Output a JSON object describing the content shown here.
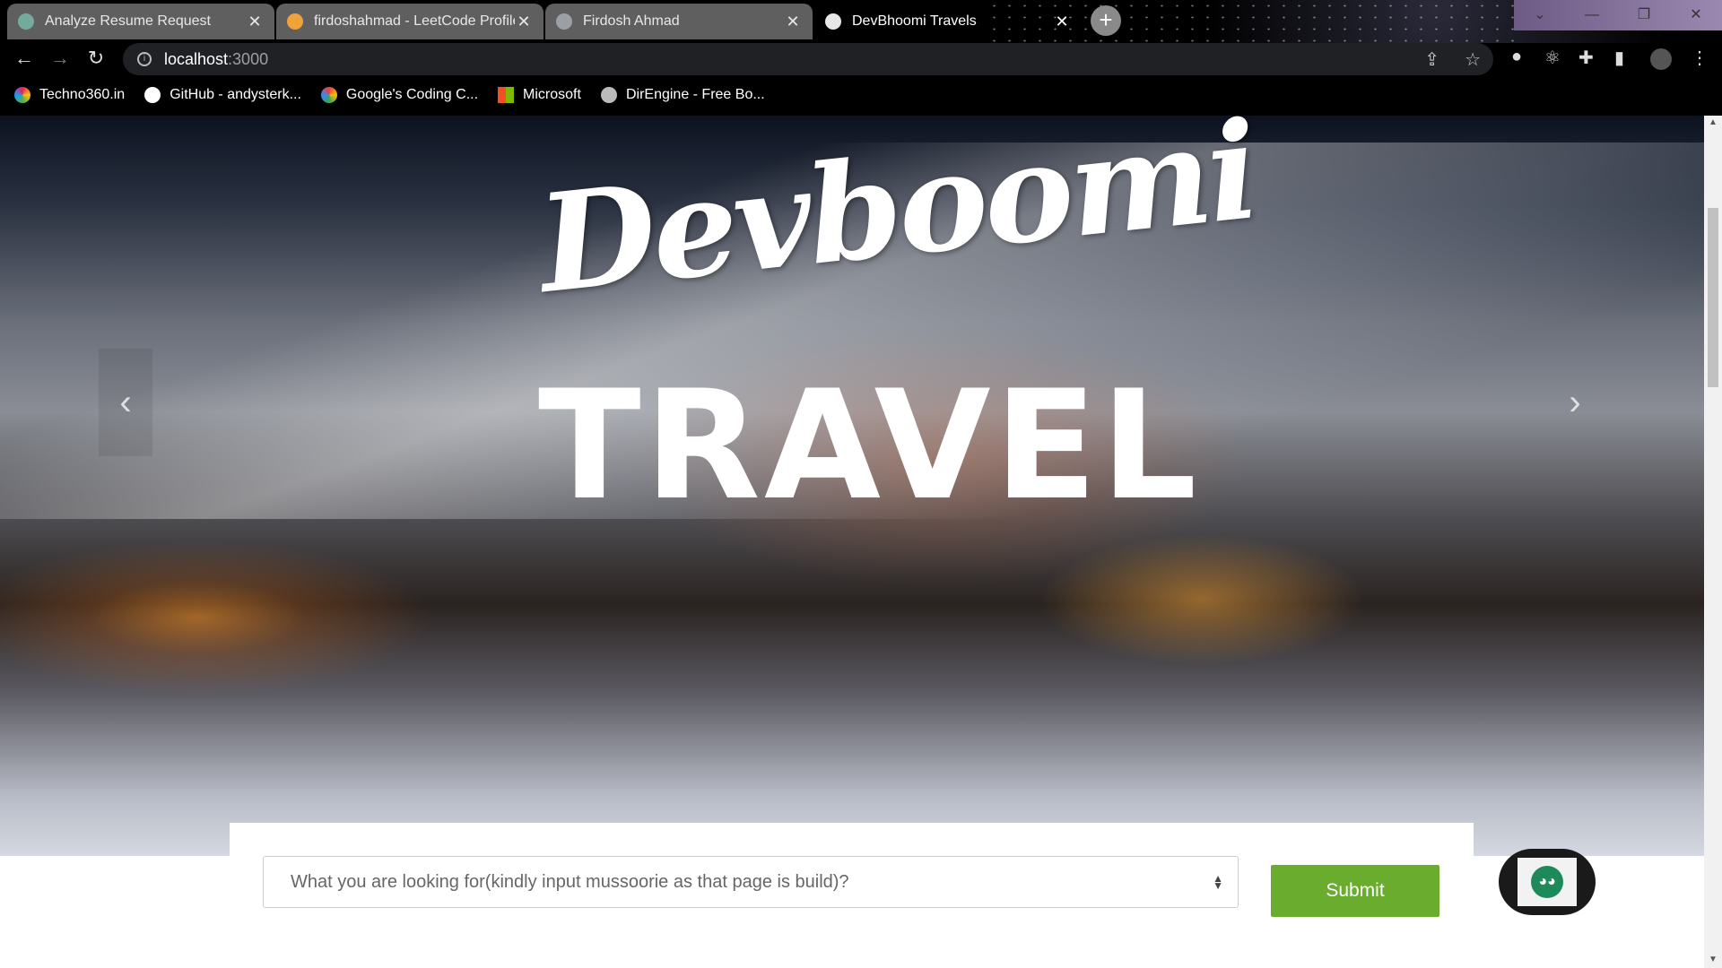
{
  "browser": {
    "tabs": [
      {
        "title": "Analyze Resume Request",
        "favicon_color": "#74aa9c"
      },
      {
        "title": "firdoshahmad - LeetCode Profile",
        "favicon_color": "#f0a33a"
      },
      {
        "title": "Firdosh Ahmad",
        "favicon_color": "#9aa0a6"
      },
      {
        "title": "DevBhoomi Travels",
        "favicon_color": "#e8e8e8"
      }
    ],
    "new_tab": "+",
    "address": {
      "host": "localhost",
      "port": ":3000"
    },
    "bookmarks": [
      {
        "label": "Techno360.in",
        "color": "#e91e63"
      },
      {
        "label": "GitHub - andysterk...",
        "color": "#ffffff"
      },
      {
        "label": "Google's Coding C...",
        "color": "#4285f4"
      },
      {
        "label": "Microsoft",
        "color": "#f25022"
      },
      {
        "label": "DirEngine - Free Bo...",
        "color": "#bbbbbb"
      }
    ]
  },
  "hero": {
    "brand_script": "Devboomi",
    "brand_block": "TRAVEL",
    "prev_arrow": "‹",
    "next_arrow": "›"
  },
  "search": {
    "placeholder": "What you are looking for(kindly input mussoorie as that page is build)?",
    "submit_label": "Submit"
  },
  "colors": {
    "submit": "#6aad2e",
    "chatbot": "#1e8a5a"
  }
}
